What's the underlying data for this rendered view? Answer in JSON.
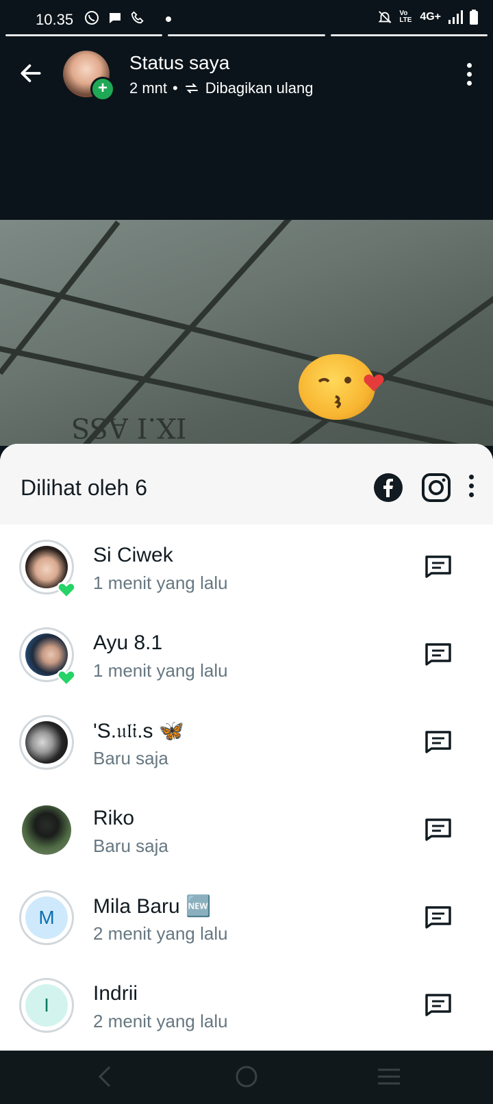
{
  "statusbar": {
    "time": "10.35",
    "network": "4G+",
    "volte": "Vo LTE"
  },
  "header": {
    "title": "Status saya",
    "time_ago": "2 mnt",
    "separator": "•",
    "reshared": "Dibagikan ulang"
  },
  "photo": {
    "class_label": "IX.I   ASS"
  },
  "sheet": {
    "title": "Dilihat oleh 6"
  },
  "viewers": [
    {
      "name": "Si Ciwek",
      "time": "1 menit yang lalu",
      "liked": true
    },
    {
      "name": "Ayu 8.1",
      "time": "1 menit yang lalu",
      "liked": true
    },
    {
      "name": "'S.𝔲𝔩𝔦.s 🦋",
      "time": "Baru saja",
      "liked": false
    },
    {
      "name": "Riko",
      "time": "Baru saja",
      "liked": false
    },
    {
      "name": "Mila Baru 🆕",
      "time": "2 menit yang lalu",
      "liked": false,
      "initial": "M"
    },
    {
      "name": "Indrii",
      "time": "2 menit yang lalu",
      "liked": false,
      "initial": "I"
    }
  ],
  "colors": {
    "background": "#0b141a",
    "accent_green": "#1fa855",
    "like_green": "#25d366",
    "text_primary": "#111b21",
    "text_secondary": "#667781"
  }
}
